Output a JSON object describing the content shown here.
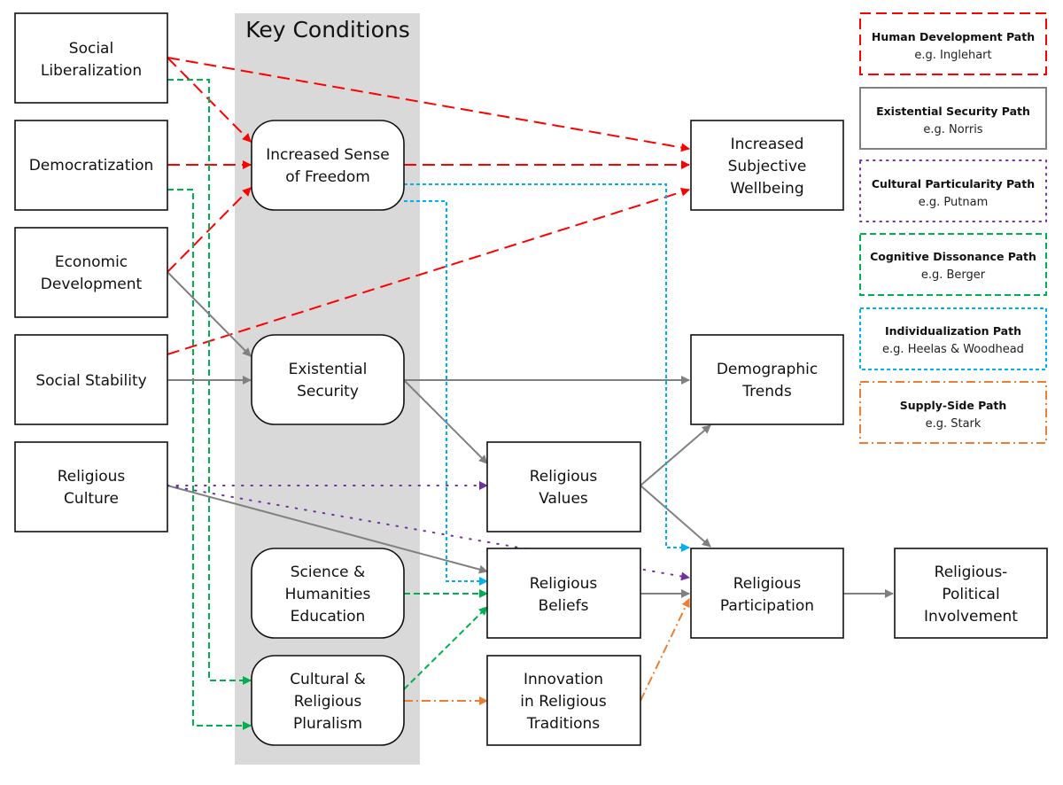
{
  "band": {
    "title": "Key Conditions"
  },
  "nodes": {
    "social_liberalization": [
      "Social",
      "Liberalization"
    ],
    "democratization": [
      "Democratization"
    ],
    "economic_development": [
      "Economic",
      "Development"
    ],
    "social_stability": [
      "Social Stability"
    ],
    "religious_culture": [
      "Religious",
      "Culture"
    ],
    "sense_of_freedom": [
      "Increased Sense",
      "of Freedom"
    ],
    "existential_security": [
      "Existential",
      "Security"
    ],
    "science_education": [
      "Science &",
      "Humanities",
      "Education"
    ],
    "pluralism": [
      "Cultural &",
      "Religious",
      "Pluralism"
    ],
    "subjective_wellbeing": [
      "Increased",
      "Subjective",
      "Wellbeing"
    ],
    "demographic_trends": [
      "Demographic",
      "Trends"
    ],
    "religious_values": [
      "Religious",
      "Values"
    ],
    "religious_beliefs": [
      "Religious",
      "Beliefs"
    ],
    "innovation": [
      "Innovation",
      "in Religious",
      "Traditions"
    ],
    "religious_participation": [
      "Religious",
      "Participation"
    ],
    "political_involvement": [
      "Religious-",
      "Political",
      "Involvement"
    ]
  },
  "legend": [
    {
      "id": "human",
      "title": "Human Development Path",
      "example": "e.g. Inglehart",
      "color": "#ff0000",
      "style": "long-dash"
    },
    {
      "id": "existential",
      "title": "Existential Security Path",
      "example": "e.g. Norris",
      "color": "#808080",
      "style": "solid"
    },
    {
      "id": "cultural",
      "title": "Cultural Particularity Path",
      "example": "e.g. Putnam",
      "color": "#7030a0",
      "style": "dotted"
    },
    {
      "id": "cognitive",
      "title": "Cognitive Dissonance Path",
      "example": "e.g. Berger",
      "color": "#00b050",
      "style": "dashed"
    },
    {
      "id": "individual",
      "title": "Individualization Path",
      "example": "e.g. Heelas & Woodhead",
      "color": "#00b0f0",
      "style": "short-dot"
    },
    {
      "id": "supply",
      "title": "Supply-Side Path",
      "example": "e.g. Stark",
      "color": "#ed7d31",
      "style": "dash-dot"
    }
  ],
  "edges": [
    {
      "from": "social_liberalization",
      "to": "sense_of_freedom",
      "path": "human"
    },
    {
      "from": "social_liberalization",
      "to": "subjective_wellbeing",
      "path": "human"
    },
    {
      "from": "democratization",
      "to": "sense_of_freedom",
      "path": "human"
    },
    {
      "from": "economic_development",
      "to": "sense_of_freedom",
      "path": "human"
    },
    {
      "from": "social_stability",
      "to": "subjective_wellbeing",
      "path": "human"
    },
    {
      "from": "sense_of_freedom",
      "to": "subjective_wellbeing",
      "path": "human"
    },
    {
      "from": "economic_development",
      "to": "existential_security",
      "path": "existential"
    },
    {
      "from": "social_stability",
      "to": "existential_security",
      "path": "existential"
    },
    {
      "from": "existential_security",
      "to": "demographic_trends",
      "path": "existential"
    },
    {
      "from": "existential_security",
      "to": "religious_values",
      "path": "existential"
    },
    {
      "from": "religious_values",
      "to": "demographic_trends",
      "path": "existential"
    },
    {
      "from": "religious_values",
      "to": "religious_participation",
      "path": "existential"
    },
    {
      "from": "religious_culture",
      "to": "religious_beliefs",
      "path": "existential"
    },
    {
      "from": "religious_beliefs",
      "to": "religious_participation",
      "path": "existential"
    },
    {
      "from": "religious_participation",
      "to": "political_involvement",
      "path": "existential"
    },
    {
      "from": "religious_culture",
      "to": "religious_values",
      "path": "cultural"
    },
    {
      "from": "religious_culture",
      "to": "religious_participation",
      "path": "cultural"
    },
    {
      "from": "social_liberalization",
      "to": "pluralism",
      "path": "cognitive"
    },
    {
      "from": "democratization",
      "to": "pluralism",
      "path": "cognitive"
    },
    {
      "from": "science_education",
      "to": "religious_beliefs",
      "path": "cognitive"
    },
    {
      "from": "pluralism",
      "to": "religious_beliefs",
      "path": "cognitive"
    },
    {
      "from": "sense_of_freedom",
      "to": "religious_beliefs",
      "path": "individual"
    },
    {
      "from": "sense_of_freedom",
      "to": "religious_participation",
      "path": "individual"
    },
    {
      "from": "pluralism",
      "to": "innovation",
      "path": "supply"
    },
    {
      "from": "innovation",
      "to": "religious_participation",
      "path": "supply"
    }
  ]
}
